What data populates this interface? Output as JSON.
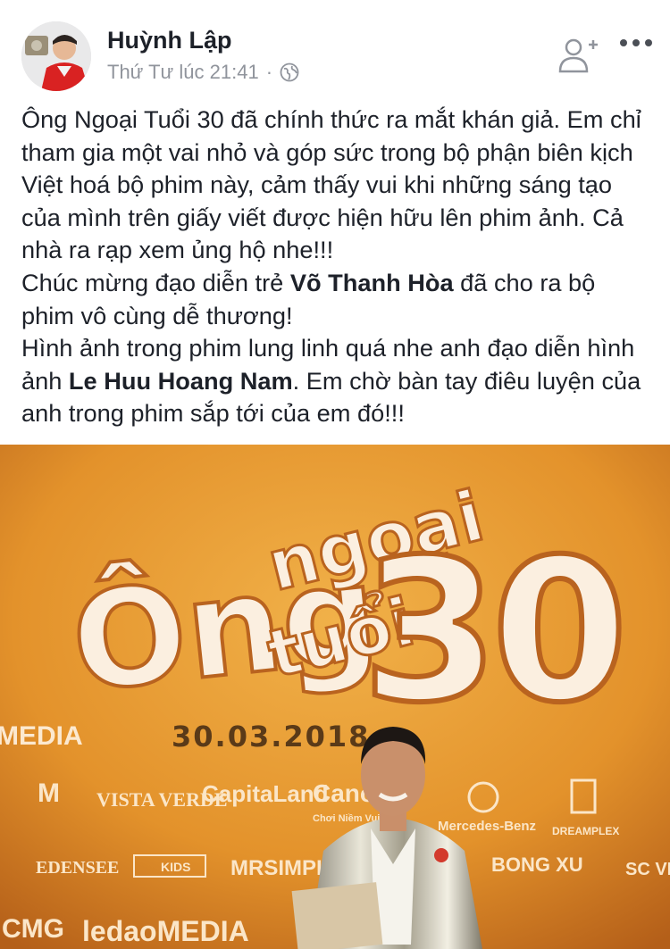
{
  "post": {
    "author": "Huỳnh Lập",
    "timestamp": "Thứ Tư lúc 21:41",
    "separator": "·",
    "privacy_icon": "globe-icon",
    "actions": {
      "add_friend_icon": "add-friend-icon",
      "more_icon": "more-options-icon"
    },
    "text": {
      "p1": "Ông Ngoại Tuổi 30 đã chính thức ra mắt khán giả. Em chỉ tham gia một vai nhỏ và góp sức trong bộ phận biên kịch Việt hoá bộ phim này, cảm thấy vui khi những sáng tạo của mình trên giấy viết được hiện hữu lên phim ảnh. Cả nhà ra rạp xem ủng hộ nhe!!!",
      "p2_before": "Chúc mừng đạo diễn trẻ ",
      "p2_bold": "Võ Thanh Hòa",
      "p2_after": " đã cho ra bộ phim vô cùng dễ thương!",
      "p3_before": "Hình ảnh trong phim lung linh quá nhe anh đạo diễn hình ảnh  ",
      "p3_bold": "Le Huu Hoang Nam",
      "p3_after": ". Em chờ bàn tay điêu luyện của anh trong phim sắp tới của em đó!!!"
    }
  },
  "photo": {
    "title_word_1": "Ông",
    "title_word_2": "ngoại",
    "title_word_3": "tuổi",
    "title_number": "30",
    "release_date": "30.03.2018",
    "sponsors": [
      "MEDIA",
      "VISTA VERDE",
      "CapitaLand",
      "Canon",
      "Mercedes-Benz",
      "DREAMPLEX",
      "EDENSEE",
      "MRSIMPLE",
      "BONG XU",
      "SC VIVO",
      "CMG",
      "ledaoMEDIA"
    ],
    "sponsor_labels": {
      "m_small": "M",
      "cano_small": "Chơi Niềm Vui",
      "dream_small": "",
      "kids": "KIDS"
    },
    "backdrop_color": "#e89b2f",
    "jacket_color": "#d8d4c4"
  }
}
